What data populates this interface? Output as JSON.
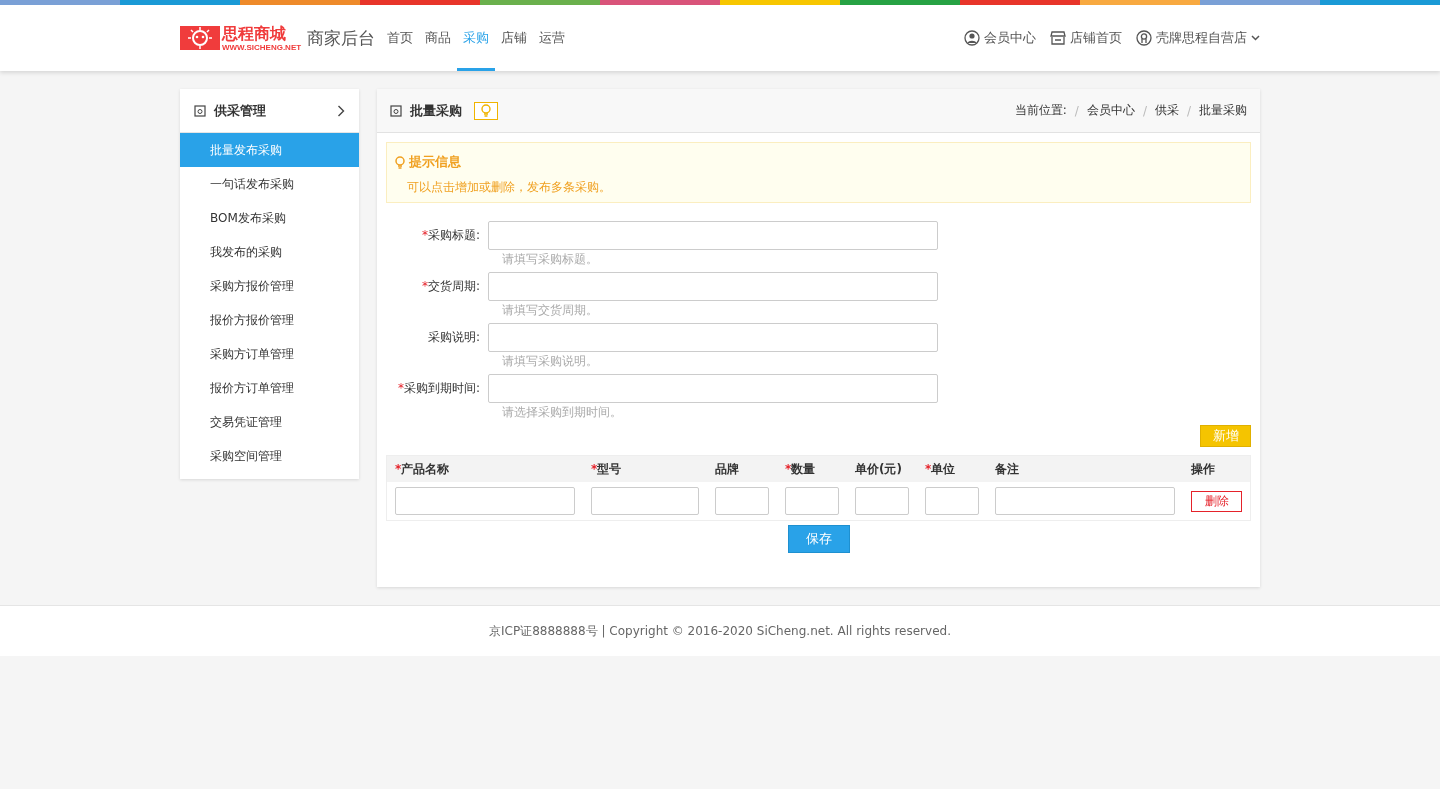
{
  "header": {
    "logo": {
      "name": "思程商城",
      "url": "WWW.SICHENG.NET"
    },
    "subtitle": "商家后台",
    "nav": [
      {
        "label": "首页",
        "selected": false
      },
      {
        "label": "商品",
        "selected": false
      },
      {
        "label": "采购",
        "selected": true
      },
      {
        "label": "店铺",
        "selected": false
      },
      {
        "label": "运营",
        "selected": false
      }
    ],
    "links": [
      {
        "kind": "member",
        "label": "会员中心"
      },
      {
        "kind": "store",
        "label": "店铺首页"
      },
      {
        "kind": "account",
        "label": "壳牌思程自营店",
        "dropdown": true
      }
    ]
  },
  "sidebar": {
    "title": "供采管理",
    "items": [
      {
        "label": "批量发布采购",
        "selected": true
      },
      {
        "label": "一句话发布采购",
        "selected": false
      },
      {
        "label": "BOM发布采购",
        "selected": false
      },
      {
        "label": "我发布的采购",
        "selected": false
      },
      {
        "label": "采购方报价管理",
        "selected": false
      },
      {
        "label": "报价方报价管理",
        "selected": false
      },
      {
        "label": "采购方订单管理",
        "selected": false
      },
      {
        "label": "报价方订单管理",
        "selected": false
      },
      {
        "label": "交易凭证管理",
        "selected": false
      },
      {
        "label": "采购空间管理",
        "selected": false
      }
    ]
  },
  "panel": {
    "title": "批量采购",
    "breadcrumb_label": "当前位置:",
    "breadcrumb_separator": "/",
    "breadcrumb": [
      "会员中心",
      "供采",
      "批量采购"
    ],
    "tip": {
      "title": "提示信息",
      "text": "可以点击增加或删除，发布多条采购。"
    },
    "fields": [
      {
        "required_mark": "*",
        "label": "采购标题:",
        "hint": "请填写采购标题。"
      },
      {
        "required_mark": "*",
        "label": "交货周期:",
        "hint": "请填写交货周期。"
      },
      {
        "label": "采购说明:",
        "hint": "请填写采购说明。"
      },
      {
        "required_mark": "*",
        "label": "采购到期时间:",
        "hint": "请选择采购到期时间。"
      }
    ],
    "add_button": "新增",
    "table": {
      "columns": [
        {
          "required_mark": "*",
          "label": "产品名称"
        },
        {
          "required_mark": "*",
          "label": "型号"
        },
        {
          "label": "品牌"
        },
        {
          "required_mark": "*",
          "label": "数量"
        },
        {
          "label": "单价(元)"
        },
        {
          "required_mark": "*",
          "label": "单位"
        },
        {
          "label": "备注"
        },
        {
          "label": "操作"
        }
      ],
      "rows": [
        {
          "delete_button": "删除"
        }
      ]
    },
    "save_button": "保存"
  },
  "footer": "京ICP证8888888号 | Copyright © 2016-2020 SiCheng.net. All rights reserved."
}
